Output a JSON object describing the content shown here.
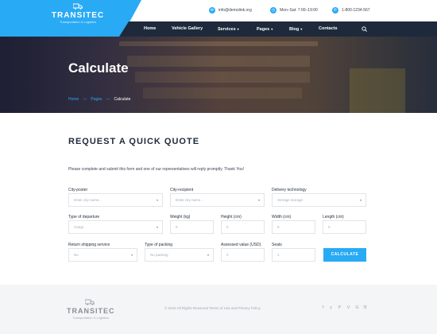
{
  "header": {
    "brand": "TRANSITEC",
    "tagline": "Transportation & Logistics",
    "email": "info@demolink.org",
    "hours": "Mon–Sat: 7:00–19:00",
    "phone": "1-800-1234-567"
  },
  "nav": [
    {
      "label": "Home"
    },
    {
      "label": "Vehicle Gallery"
    },
    {
      "label": "Services",
      "caret": "▾"
    },
    {
      "label": "Pages",
      "caret": "▾"
    },
    {
      "label": "Blog",
      "caret": "▾"
    },
    {
      "label": "Contacts"
    }
  ],
  "hero": {
    "title": "Calculate",
    "breadcrumb": {
      "home": "Home",
      "pages": "Pages",
      "current": "Calculate",
      "sep": "—"
    }
  },
  "form": {
    "title": "REQUEST A QUICK QUOTE",
    "intro": "Please complete and submit this form and one of our representatives will reply promptly. Thank You!",
    "row1": [
      {
        "label": "City-poster",
        "value": "Enter city name...",
        "select": true
      },
      {
        "label": "City-recipient",
        "value": "Enter city name...",
        "select": true
      },
      {
        "label": "Delivery technology",
        "value": "Storage storage",
        "select": true
      }
    ],
    "row2": [
      {
        "label": "Type of departure",
        "value": "Cargo",
        "select": true
      },
      {
        "label": "Weight (kg)",
        "value": "0"
      },
      {
        "label": "Height (cm)",
        "value": "0"
      },
      {
        "label": "Width (cm)",
        "value": "0"
      },
      {
        "label": "Length (cm)",
        "value": "0"
      }
    ],
    "row3": [
      {
        "label": "Return shipping service",
        "value": "No",
        "select": true
      },
      {
        "label": "Type of packing",
        "value": "No packing",
        "select": true
      },
      {
        "label": "Assessed value (USD)",
        "value": "0"
      },
      {
        "label": "Seats",
        "value": "1"
      }
    ],
    "submit": "CALCULATE",
    "dropdown_glyph": "▾"
  },
  "footer": {
    "brand": "TRANSITEC",
    "tagline": "Transportation & Logistics",
    "copyright": "© 2016 All Rights Reserved Terms of Use and Privacy Policy",
    "social": [
      {
        "icon": "facebook-icon",
        "glyph": "f"
      },
      {
        "icon": "twitter-icon",
        "glyph": "y"
      },
      {
        "icon": "pinterest-icon",
        "glyph": "P"
      },
      {
        "icon": "vimeo-icon",
        "glyph": "V"
      },
      {
        "icon": "google-icon",
        "glyph": "G"
      },
      {
        "icon": "rss-icon",
        "glyph": "ℜ"
      }
    ]
  },
  "colors": {
    "accent": "#29aaf4",
    "nav_bg": "#1e2a3b",
    "footer_bg": "#f4f5f7"
  }
}
